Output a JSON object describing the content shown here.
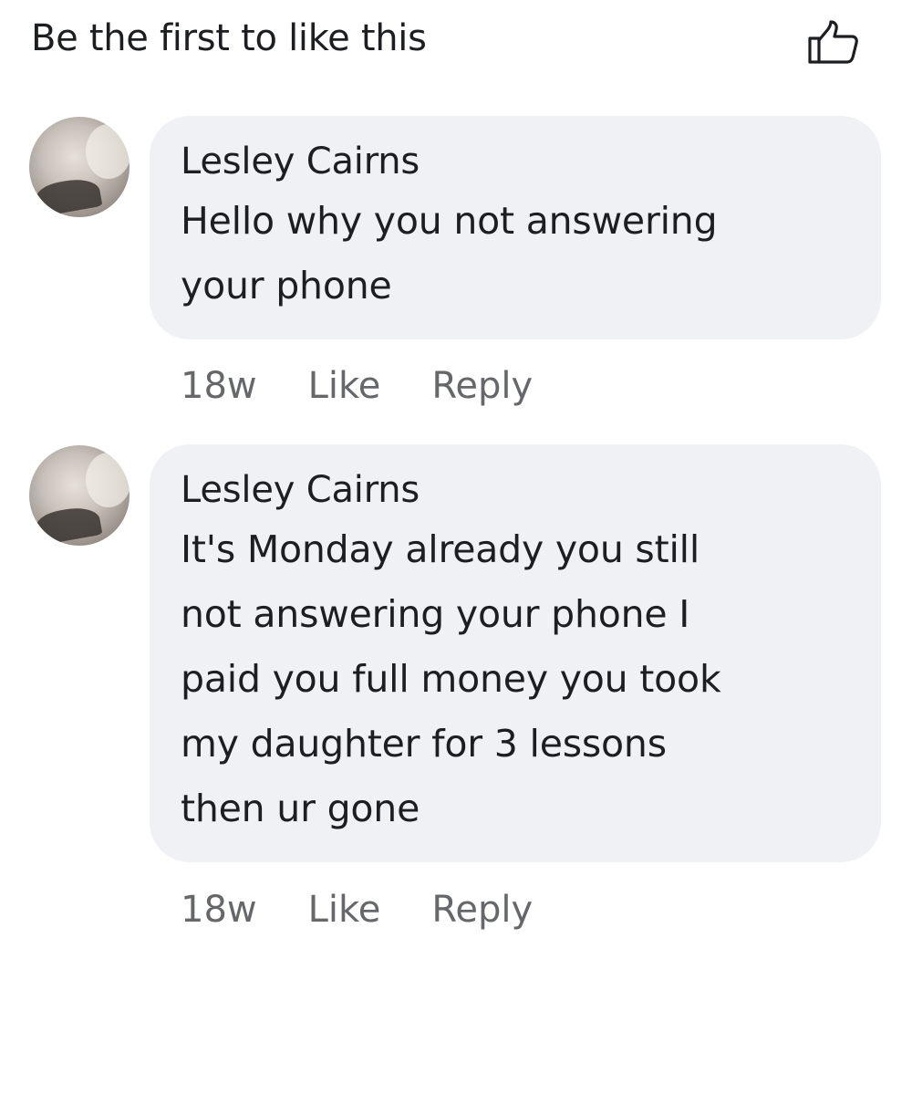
{
  "likes": {
    "summary": "Be the first to like this",
    "icon": "thumbs-up-icon"
  },
  "comments": [
    {
      "author": "Lesley Cairns",
      "text": "Hello why you not answering\nyour phone",
      "time": "18w",
      "like_label": "Like",
      "reply_label": "Reply"
    },
    {
      "author": "Lesley Cairns",
      "text": "It's Monday already you still\nnot answering your phone I\npaid you full money you took\nmy daughter for 3 lessons\nthen ur gone",
      "time": "18w",
      "like_label": "Like",
      "reply_label": "Reply"
    }
  ],
  "colors": {
    "bubble": "#f0f1f4",
    "meta_text": "#65676b",
    "text": "#1c1e21"
  }
}
